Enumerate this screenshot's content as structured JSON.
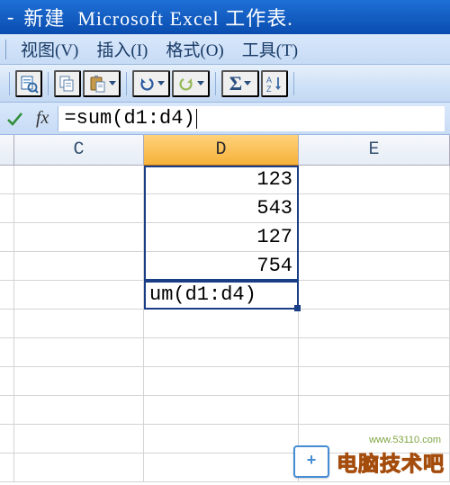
{
  "title": {
    "dash": "-",
    "zh": "新建",
    "en": "Microsoft Excel 工作表."
  },
  "menu": {
    "view": "视图(V)",
    "insert": "插入(I)",
    "format": "格式(O)",
    "tools": "工具(T)"
  },
  "formula_bar": {
    "fx_label": "fx",
    "formula": "=sum(d1:d4)"
  },
  "columns": {
    "c": "C",
    "d": "D",
    "e": "E"
  },
  "cells": {
    "d1": "123",
    "d2": "543",
    "d3": "127",
    "d4": "754",
    "d5": "um(d1:d4)"
  },
  "watermark": {
    "url": "www.53110.com",
    "text": "电脑技术吧",
    "badge": "+"
  }
}
